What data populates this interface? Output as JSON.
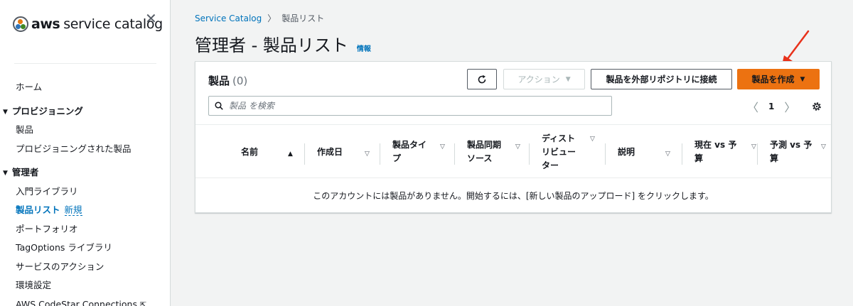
{
  "sidebar": {
    "logo_bold": "aws",
    "logo_text": "service catalog",
    "close_glyph": "✕",
    "items": [
      {
        "type": "item",
        "label": "ホーム"
      },
      {
        "type": "section",
        "label": "プロビジョニング"
      },
      {
        "type": "item",
        "label": "製品"
      },
      {
        "type": "item",
        "label": "プロビジョニングされた製品"
      },
      {
        "type": "section",
        "label": "管理者"
      },
      {
        "type": "item",
        "label": "入門ライブラリ"
      },
      {
        "type": "item",
        "label": "製品リスト",
        "badge": "新規"
      },
      {
        "type": "item",
        "label": "ポートフォリオ"
      },
      {
        "type": "item",
        "label": "TagOptions ライブラリ"
      },
      {
        "type": "item",
        "label": "サービスのアクション"
      },
      {
        "type": "item",
        "label": "環境設定"
      },
      {
        "type": "item",
        "label": "AWS CodeStar Connections"
      }
    ]
  },
  "breadcrumb": {
    "root": "Service Catalog",
    "current": "製品リスト"
  },
  "page": {
    "title": "管理者 - 製品リスト",
    "info": "情報"
  },
  "panel": {
    "title": "製品",
    "count": "(0)",
    "actions_label": "アクション",
    "connect_label": "製品を外部リポジトリに接続",
    "create_label": "製品を作成",
    "search_placeholder": "製品 を検索",
    "page_number": "1"
  },
  "table": {
    "columns": [
      {
        "line1": "名前",
        "line2": "",
        "line3": ""
      },
      {
        "line1": "作成日",
        "line2": "",
        "line3": ""
      },
      {
        "line1": "製品タイ",
        "line2": "プ",
        "line3": ""
      },
      {
        "line1": "製品同期",
        "line2": "ソース",
        "line3": ""
      },
      {
        "line1": "ディスト",
        "line2": "リビュー",
        "line3": "ター"
      },
      {
        "line1": "説明",
        "line2": "",
        "line3": ""
      },
      {
        "line1": "現在 vs 予",
        "line2": "算",
        "line3": ""
      },
      {
        "line1": "予測 vs 予",
        "line2": "算",
        "line3": ""
      }
    ],
    "empty_message": "このアカウントには製品がありません。開始するには、[新しい製品のアップロード] をクリックします。"
  },
  "colors": {
    "link": "#0073bb",
    "primary_button": "#ec7211",
    "annotation_arrow": "#e8311a"
  },
  "icons": [
    "aws-service-catalog-logo",
    "close-icon",
    "chevron-right-icon",
    "refresh-icon",
    "caret-down-icon",
    "search-icon",
    "chevron-left-icon",
    "gear-icon",
    "sort-ascending-icon",
    "sort-icon",
    "external-link-icon",
    "annotation-arrow"
  ]
}
